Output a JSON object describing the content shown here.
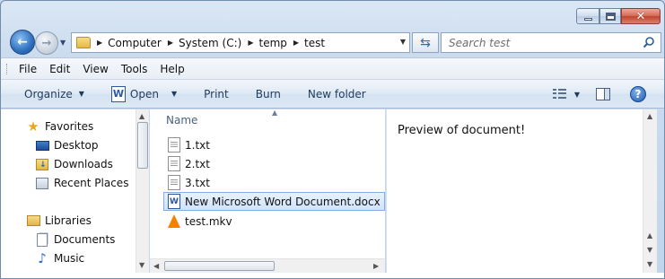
{
  "address": {
    "crumbs": [
      "Computer",
      "System (C:)",
      "temp",
      "test"
    ]
  },
  "search": {
    "placeholder": "Search test"
  },
  "menu": [
    "File",
    "Edit",
    "View",
    "Tools",
    "Help"
  ],
  "commands": {
    "organize": "Organize",
    "open": "Open",
    "print": "Print",
    "burn": "Burn",
    "new_folder": "New folder"
  },
  "nav": {
    "favorites_label": "Favorites",
    "favorites": [
      "Desktop",
      "Downloads",
      "Recent Places"
    ],
    "libraries_label": "Libraries",
    "libraries": [
      "Documents",
      "Music"
    ]
  },
  "files": {
    "column_name": "Name",
    "items": [
      {
        "name": "1.txt",
        "icon": "text-file-icon",
        "selected": false
      },
      {
        "name": "2.txt",
        "icon": "text-file-icon",
        "selected": false
      },
      {
        "name": "3.txt",
        "icon": "text-file-icon",
        "selected": false
      },
      {
        "name": "New Microsoft Word Document.docx",
        "icon": "word-document-icon",
        "selected": true
      },
      {
        "name": "test.mkv",
        "icon": "vlc-media-icon",
        "selected": false
      }
    ]
  },
  "preview": {
    "text": "Preview of document!"
  },
  "colors": {
    "selection": "#cfe3fb",
    "accent": "#2e6fbd",
    "close": "#c2432c"
  }
}
